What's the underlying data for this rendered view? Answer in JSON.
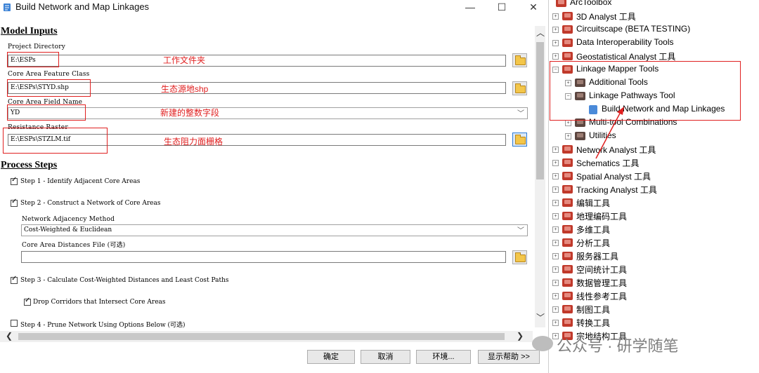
{
  "dialog": {
    "title": "Build Network and Map Linkages",
    "minimize": "—",
    "maximize": "☐",
    "close": "✕"
  },
  "model_inputs": {
    "heading": "Model Inputs",
    "project_dir_label": "Project Directory",
    "project_dir_value": "E:\\ESPs",
    "core_fc_label": "Core Area Feature Class",
    "core_fc_value": "E:\\ESPs\\STYD.shp",
    "core_field_label": "Core Area Field Name",
    "core_field_value": "YD",
    "resistance_label": "Resistance Raster",
    "resistance_value": "E:\\ESPs\\STZLM.tif"
  },
  "annotations": {
    "a1": "工作文件夹",
    "a2": "生态源地shp",
    "a3": "新建的整数字段",
    "a4": "生态阻力面栅格"
  },
  "process": {
    "heading": "Process Steps",
    "step1": "Step 1 - Identify Adjacent Core Areas",
    "step2": "Step 2 - Construct a Network of Core Areas",
    "adj_label": "Network Adjacency Method",
    "adj_value": "Cost-Weighted & Euclidean",
    "dist_label": "Core Area Distances File (可选)",
    "dist_value": "",
    "step3": "Step 3 - Calculate Cost-Weighted Distances and Least Cost Paths",
    "drop_corr": "Drop Corridors that Intersect Core Areas",
    "step4": "Step 4 - Prune Network Using Options Below (可选)"
  },
  "buttons": {
    "ok": "确定",
    "cancel": "取消",
    "env": "环境...",
    "help": "显示帮助 >>"
  },
  "toolbox": {
    "root": "ArcToolbox",
    "items": [
      "3D Analyst 工具",
      "Circuitscape (BETA TESTING)",
      "Data Interoperability Tools",
      "Geostatistical Analyst 工具",
      "Linkage Mapper Tools",
      "Additional Tools",
      "Linkage Pathways Tool",
      "Build Network and Map Linkages",
      "Multi-tool Combinations",
      "Utilities",
      "Network Analyst 工具",
      "Schematics 工具",
      "Spatial Analyst 工具",
      "Tracking Analyst 工具",
      "编辑工具",
      "地理编码工具",
      "多维工具",
      "分析工具",
      "服务器工具",
      "空间统计工具",
      "数据管理工具",
      "线性参考工具",
      "制图工具",
      "转换工具",
      "宗地结构工具"
    ]
  },
  "watermark": "公众号 · 研学随笔",
  "colors": {
    "annotation": "#e02020",
    "toolbox_icon": "#c0392b"
  }
}
